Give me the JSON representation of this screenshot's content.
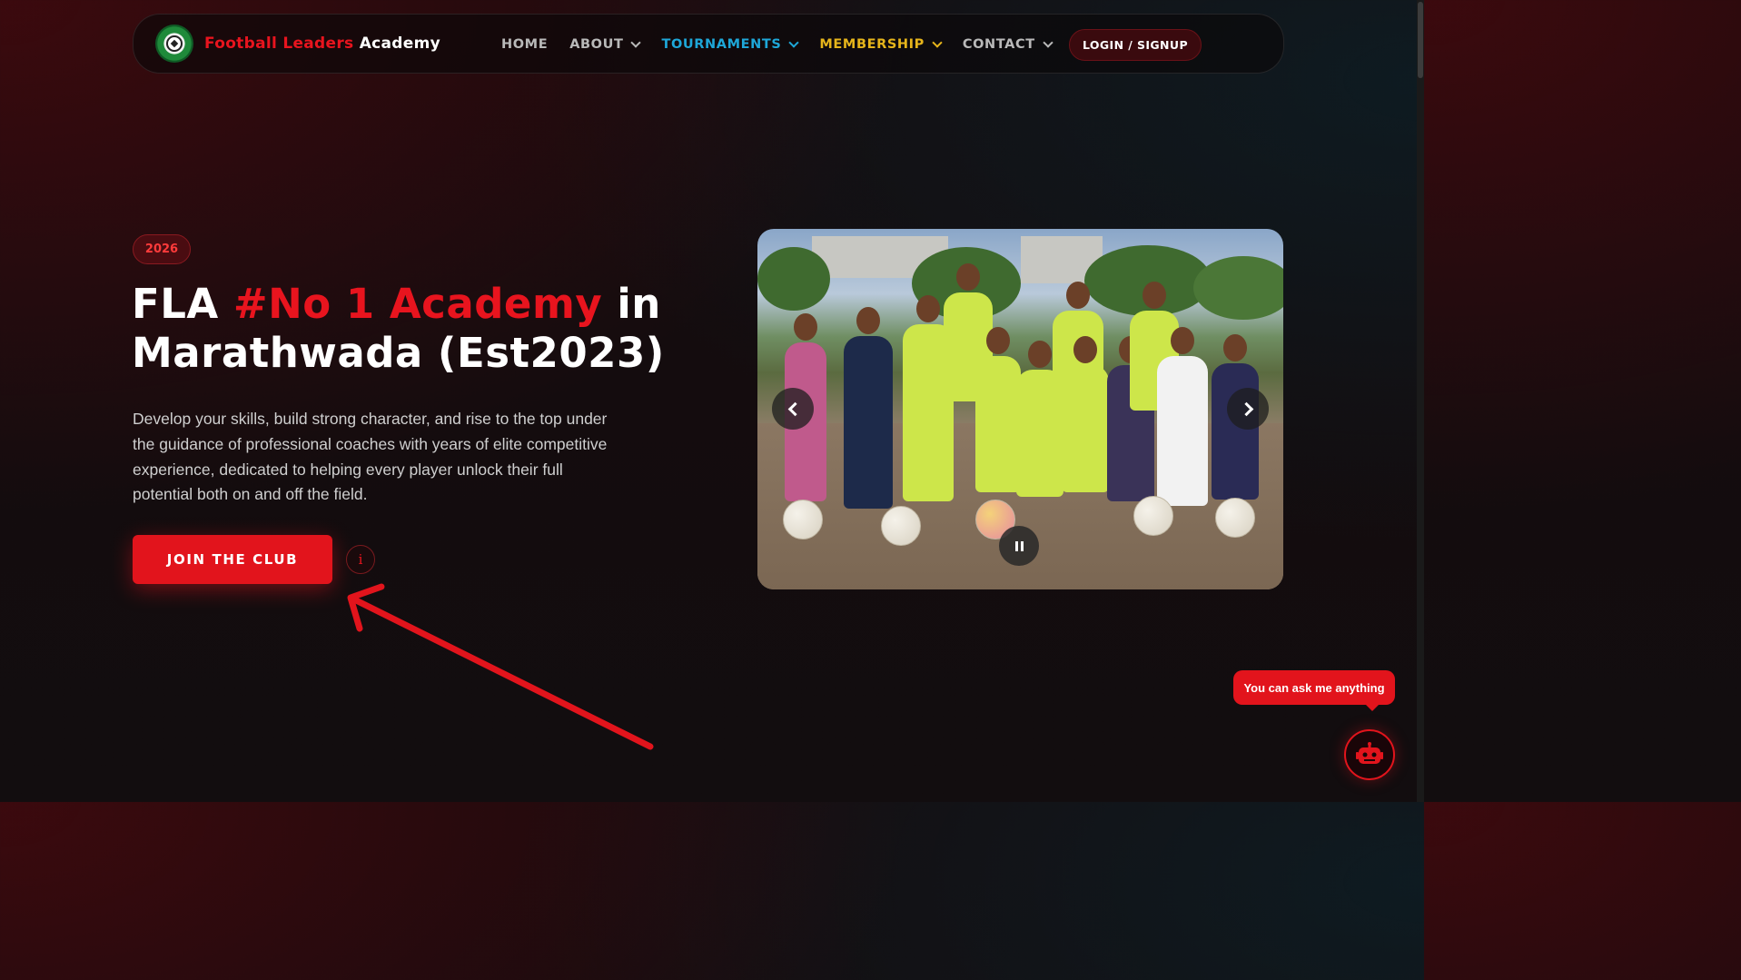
{
  "brand": {
    "part1": "Football Leaders",
    "part2": "Academy"
  },
  "nav": {
    "items": [
      {
        "label": "HOME"
      },
      {
        "label": "ABOUT"
      },
      {
        "label": "TOURNAMENTS"
      },
      {
        "label": "MEMBERSHIP"
      },
      {
        "label": "CONTACT"
      }
    ],
    "login_label": "LOGIN / SIGNUP"
  },
  "hero": {
    "badge": "2026",
    "title_part1": "FLA ",
    "title_highlight": "#No 1 Academy",
    "title_part2": " in Marathwada (Est2023)",
    "description": "Develop your skills, build strong character, and rise to the top under the guidance of professional coaches with years of elite competitive experience, dedicated to helping every player unlock their full potential both on and off the field.",
    "cta_label": "JOIN THE CLUB",
    "info_label": "i"
  },
  "chat": {
    "tooltip": "You can ask me anything"
  },
  "colors": {
    "accent": "#e2141c",
    "tournaments": "#1ea7d8",
    "membership": "#e6b51b"
  }
}
